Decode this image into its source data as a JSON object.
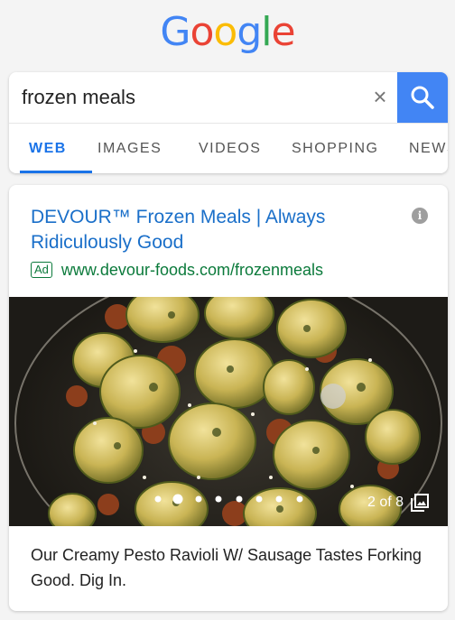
{
  "logo": {
    "letters": [
      {
        "char": "G",
        "color": "#4285f4"
      },
      {
        "char": "o",
        "color": "#ea4335"
      },
      {
        "char": "o",
        "color": "#fbbc05"
      },
      {
        "char": "g",
        "color": "#4285f4"
      },
      {
        "char": "l",
        "color": "#34a853"
      },
      {
        "char": "e",
        "color": "#ea4335"
      }
    ]
  },
  "search": {
    "query": "frozen meals",
    "clear_icon": "close-icon",
    "search_icon": "search-icon",
    "accent_color": "#4285f4"
  },
  "tabs": [
    {
      "label": "WEB",
      "active": true
    },
    {
      "label": "IMAGES",
      "active": false
    },
    {
      "label": "VIDEOS",
      "active": false
    },
    {
      "label": "SHOPPING",
      "active": false
    },
    {
      "label": "NEWS",
      "active": false
    }
  ],
  "ad": {
    "title": "DEVOUR™ Frozen Meals | Always Ridiculously Good",
    "badge": "Ad",
    "url": "www.devour-foods.com/frozenmeals",
    "info_icon": "info-icon",
    "carousel": {
      "counter": "2 of 8",
      "current": 2,
      "total": 8,
      "gallery_icon": "gallery-icon"
    },
    "description": "Our Creamy Pesto Ravioli W/ Sausage Tastes Forking Good. Dig In."
  }
}
